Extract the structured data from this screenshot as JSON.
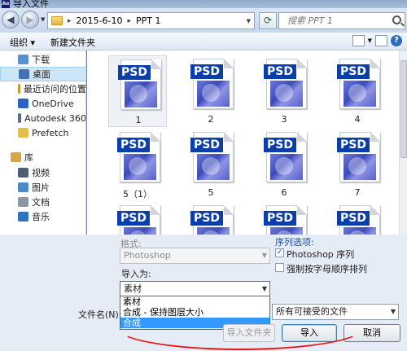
{
  "window": {
    "title": "导入文件",
    "app_icon": "Ae"
  },
  "address": {
    "crumbs": [
      "2015-6-10",
      "PPT 1"
    ],
    "sep": "▸"
  },
  "search": {
    "placeholder": "搜索 PPT 1"
  },
  "commandbar": {
    "organize": "组织 ▾",
    "new_folder": "新建文件夹"
  },
  "sidebar": {
    "items": [
      {
        "label": "下载",
        "icon": "download-folder-icon",
        "color": "#5a8fd4"
      },
      {
        "label": "桌面",
        "icon": "desktop-icon",
        "color": "#3f72b7",
        "selected": true
      },
      {
        "label": "最近访问的位置",
        "icon": "recent-places-icon",
        "color": "#c99b2c"
      },
      {
        "label": "OneDrive",
        "icon": "onedrive-icon",
        "color": "#2a64c0"
      },
      {
        "label": "Autodesk 360",
        "icon": "autodesk-360-icon",
        "color": "#5b6b80"
      },
      {
        "label": "Prefetch",
        "icon": "folder-icon",
        "color": "#e4bd4f"
      },
      {
        "label": "库",
        "icon": "libraries-icon",
        "color": "#d9a640"
      },
      {
        "label": "视频",
        "icon": "video-icon",
        "color": "#4e5f74"
      },
      {
        "label": "图片",
        "icon": "pictures-icon",
        "color": "#4b89c8"
      },
      {
        "label": "文档",
        "icon": "documents-icon",
        "color": "#8c96a4"
      },
      {
        "label": "音乐",
        "icon": "music-icon",
        "color": "#2f72c2"
      }
    ]
  },
  "files": {
    "badge": "PSD",
    "captions": [
      "1",
      "2",
      "3",
      "4",
      "5（1）",
      "5",
      "6",
      "7",
      "",
      "",
      "",
      ""
    ]
  },
  "options": {
    "format_label": "格式:",
    "format_value": "Photoshop",
    "sequence_label": "序列选项:",
    "sequence_checkbox": "Photoshop 序列",
    "sequence_checked": true,
    "alpha_checkbox": "强制按字母顺序排列",
    "alpha_checked": false,
    "import_as_label": "导入为:",
    "import_as_value": "素材",
    "import_as_options": [
      "素材",
      "合成 - 保持图层大小",
      "合成"
    ],
    "highlighted_option": "合成"
  },
  "filename": {
    "label": "文件名(N):",
    "filter_value": "所有可接受的文件"
  },
  "buttons": {
    "import_folder": "导入文件夹",
    "import": "导入",
    "cancel": "取消"
  },
  "colors": {
    "accent": "#3399ff",
    "psd_badge": "#0b3ea8",
    "annotation": "#e11111"
  }
}
